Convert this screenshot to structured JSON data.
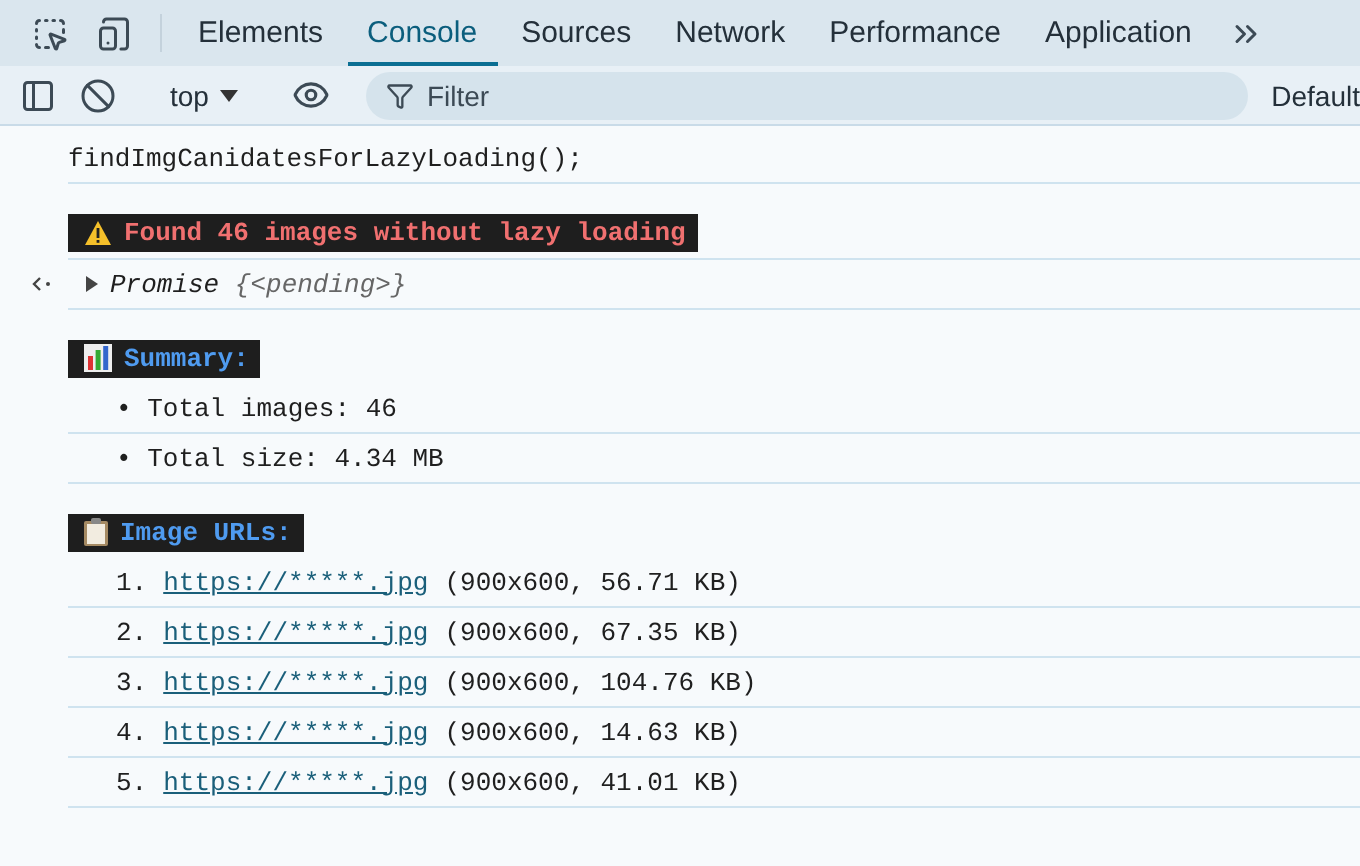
{
  "tabs": [
    {
      "label": "Elements",
      "selected": false
    },
    {
      "label": "Console",
      "selected": true
    },
    {
      "label": "Sources",
      "selected": false
    },
    {
      "label": "Network",
      "selected": false
    },
    {
      "label": "Performance",
      "selected": false
    },
    {
      "label": "Application",
      "selected": false
    }
  ],
  "toolbar": {
    "context": "top",
    "filter": {
      "placeholder": "Filter"
    },
    "levels": "Default"
  },
  "console": [
    {
      "kind": "command",
      "text": "findImgCanidatesForLazyLoading();"
    },
    {
      "kind": "warning",
      "color": "#f07070",
      "text": "Found 46 images without lazy loading"
    },
    {
      "kind": "result",
      "name": "Promise",
      "value": "{<pending>}",
      "expanded": false
    },
    {
      "kind": "summary",
      "color": "#4f9bf0",
      "text": "Summary:"
    },
    {
      "kind": "bullet",
      "text": "• Total images: 46"
    },
    {
      "kind": "bullet",
      "text": "• Total size: 4.34 MB"
    },
    {
      "kind": "listing",
      "color": "#4f9bf0",
      "text": "Image URLs:"
    },
    {
      "kind": "link",
      "number": "1.",
      "url": "https://*****.jpg",
      "detail": "(900x600, 56.71 KB)"
    },
    {
      "kind": "link",
      "number": "2.",
      "url": "https://*****.jpg",
      "detail": "(900x600, 67.35 KB)"
    },
    {
      "kind": "link",
      "number": "3.",
      "url": "https://*****.jpg",
      "detail": "(900x600, 104.76 KB)"
    },
    {
      "kind": "link",
      "number": "4.",
      "url": "https://*****.jpg",
      "detail": "(900x600, 14.63 KB)"
    },
    {
      "kind": "link",
      "number": "5.",
      "url": "https://*****.jpg",
      "detail": "(900x600, 41.01 KB)"
    }
  ]
}
